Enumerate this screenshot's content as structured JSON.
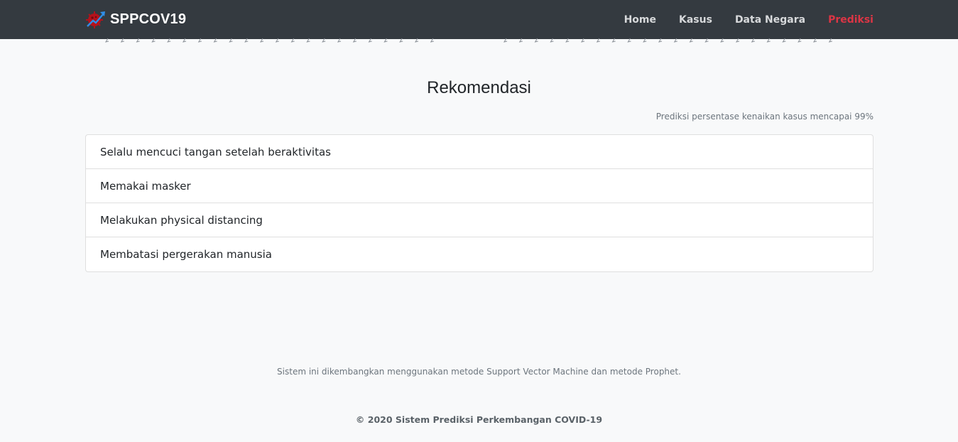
{
  "navbar": {
    "brand": "SPPCOV19",
    "brand_icon": "virus-chart-icon",
    "items": [
      {
        "label": "Home",
        "active": false
      },
      {
        "label": "Kasus",
        "active": false
      },
      {
        "label": "Data Negara",
        "active": false
      },
      {
        "label": "Prediksi",
        "active": true
      }
    ],
    "background": "#343a40",
    "active_color": "#dc3545"
  },
  "main": {
    "title": "Rekomendasi",
    "subtitle": "Prediksi persentase kenaikan kasus mencapai 99%",
    "recommendations": [
      "Selalu mencuci tangan setelah beraktivitas",
      "Memakai masker",
      "Melakukan physical distancing",
      "Membatasi pergerakan manusia"
    ]
  },
  "footer": {
    "note": "Sistem ini dikembangkan menggunakan metode Support Vector Machine dan metode Prophet.",
    "copyright": "© 2020 Sistem Prediksi Perkembangan COVID-19"
  }
}
